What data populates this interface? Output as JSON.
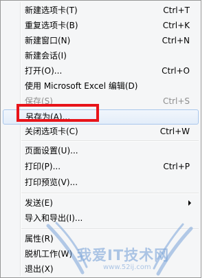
{
  "menu": {
    "items": [
      {
        "label": "新建选项卡(T)",
        "shortcut": "Ctrl+T"
      },
      {
        "label": "重复选项卡(B)",
        "shortcut": "Ctrl+K"
      },
      {
        "label": "新建窗口(N)",
        "shortcut": "Ctrl+N"
      },
      {
        "label": "新建会话(I)",
        "shortcut": ""
      },
      {
        "label": "打开(O)...",
        "shortcut": "Ctrl+O"
      },
      {
        "label": "使用 Microsoft Excel 编辑(D)",
        "shortcut": ""
      },
      {
        "label": "保存(S)",
        "shortcut": "Ctrl+S"
      },
      {
        "label": "另存为(A)...",
        "shortcut": ""
      },
      {
        "label": "关闭选项卡(C)",
        "shortcut": "Ctrl+W"
      },
      {
        "label": "页面设置(U)...",
        "shortcut": ""
      },
      {
        "label": "打印(P)...",
        "shortcut": "Ctrl+P"
      },
      {
        "label": "打印预览(V)...",
        "shortcut": ""
      },
      {
        "label": "发送(E)",
        "shortcut": ""
      },
      {
        "label": "导入和导出(I)...",
        "shortcut": ""
      },
      {
        "label": "属性(R)",
        "shortcut": ""
      },
      {
        "label": "脱机工作(W)",
        "shortcut": ""
      },
      {
        "label": "退出(X)",
        "shortcut": ""
      }
    ]
  },
  "watermark": {
    "text": "我爱IT技术网",
    "url": "www.52ij.com"
  },
  "colors": {
    "highlight_box": "#e8141a",
    "hover_border": "#a8c7ec",
    "menu_bg": "#f5f6f7"
  }
}
